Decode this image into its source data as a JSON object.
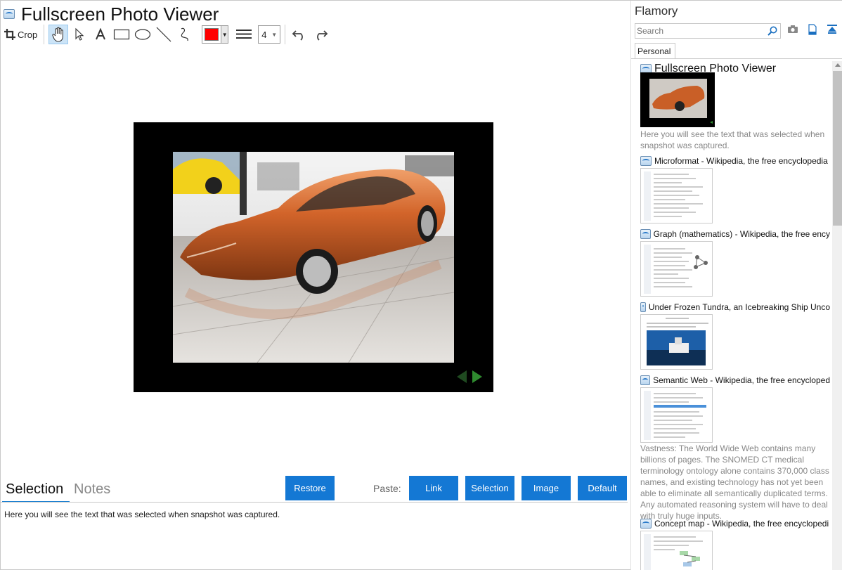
{
  "window": {
    "title": "Fullscreen Photo Viewer"
  },
  "toolbar": {
    "crop_label": "Crop",
    "line_width": "4",
    "stroke_color": "#ff0000",
    "tools": [
      "hand-icon",
      "pointer-icon",
      "text-icon",
      "rectangle-icon",
      "ellipse-icon",
      "line-icon",
      "freehand-icon",
      "undo-icon",
      "redo-icon"
    ]
  },
  "viewer": {
    "photo_subject": "orange sports car in showroom"
  },
  "bottom": {
    "tabs": [
      {
        "label": "Selection",
        "active": true
      },
      {
        "label": "Notes",
        "active": false
      }
    ],
    "restore_label": "Restore",
    "paste_label": "Paste:",
    "paste_buttons": [
      "Link",
      "Selection",
      "Image",
      "Default"
    ],
    "selection_text": "Here you will see the text that was selected when snapshot was captured."
  },
  "sidebar": {
    "title": "Flamory",
    "search_placeholder": "Search",
    "tab": "Personal",
    "items": [
      {
        "title": "Fullscreen Photo Viewer",
        "desc_lines": [
          "Here you will see the text that was selected when",
          "snapshot was captured."
        ]
      },
      {
        "title": "Microformat - Wikipedia, the free encyclopedia"
      },
      {
        "title": "Graph (mathematics) - Wikipedia, the free ency"
      },
      {
        "title": "Under Frozen Tundra, an Icebreaking Ship Unco"
      },
      {
        "title": "Semantic Web - Wikipedia, the free encycloped",
        "desc_lines": [
          "Vastness: The World Wide Web contains many",
          "billions of pages. The SNOMED CT medical",
          "terminology ontology alone contains 370,000 class",
          "names, and existing technology has not yet been",
          "able to eliminate all semantically duplicated terms.",
          "Any automated reasoning system will have to deal",
          "with truly huge inputs."
        ]
      },
      {
        "title": "Concept map - Wikipedia, the free encyclopedi"
      }
    ]
  },
  "colors": {
    "accent": "#1478d4",
    "tab_underline": "#1a7fd0"
  }
}
